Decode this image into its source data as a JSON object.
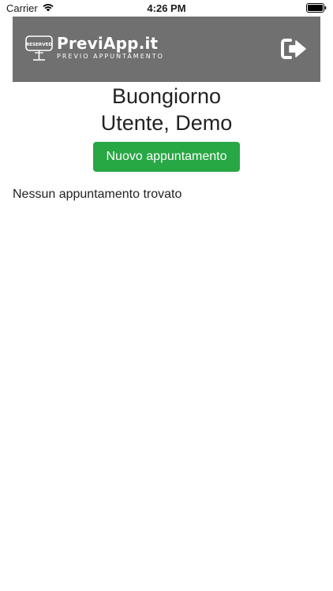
{
  "status_bar": {
    "carrier": "Carrier",
    "time": "4:26 PM",
    "icons": [
      "wifi-icon",
      "battery-icon"
    ]
  },
  "header": {
    "background_color": "#707070",
    "logo": {
      "badge_text": "RESERVED",
      "title": "PreviApp.it",
      "subtitle": "PREVIO APPUNTAMENTO"
    },
    "logout_icon": "logout-icon"
  },
  "main": {
    "greeting_line1": "Buongiorno",
    "greeting_line2": "Utente, Demo",
    "new_appointment_label": "Nuovo appuntamento",
    "new_appointment_color": "#28a745",
    "empty_message": "Nessun appuntamento trovato"
  }
}
